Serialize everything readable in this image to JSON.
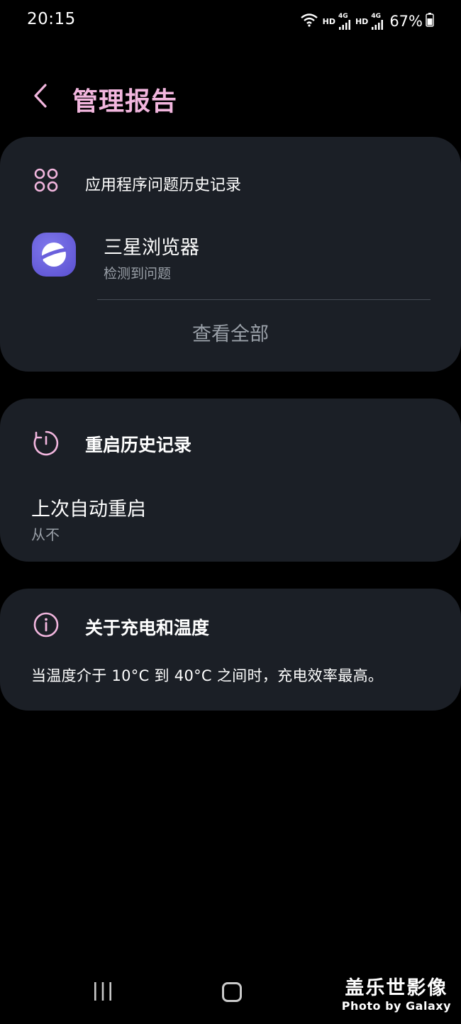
{
  "status_bar": {
    "time": "20:15",
    "hd1": "HD",
    "net1": "4G",
    "hd2": "HD",
    "net2": "4G",
    "battery": "67%"
  },
  "header": {
    "title": "管理报告"
  },
  "app_issue_card": {
    "title": "应用程序问题历史记录",
    "icon": "apps-grid-icon",
    "app_name": "三星浏览器",
    "app_status": "检测到问题",
    "app_icon": "samsung-internet-icon",
    "view_all_label": "查看全部"
  },
  "restart_card": {
    "title": "重启历史记录",
    "icon": "restart-timer-icon",
    "label": "上次自动重启",
    "value": "从不"
  },
  "charging_card": {
    "title": "关于充电和温度",
    "icon": "info-icon",
    "text": "当温度介于 10°C 到 40°C 之间时，充电效率最高。"
  },
  "nav_bar": {
    "recent_icon": "recent-apps-icon",
    "home_icon": "home-icon"
  },
  "watermark": {
    "title": "盖乐世影像",
    "subtitle": "Photo by Galaxy"
  },
  "colors": {
    "background": "#000000",
    "card": "#1b1f26",
    "accent_pink": "#f2b6de",
    "secondary_text": "#9aa0a8"
  }
}
